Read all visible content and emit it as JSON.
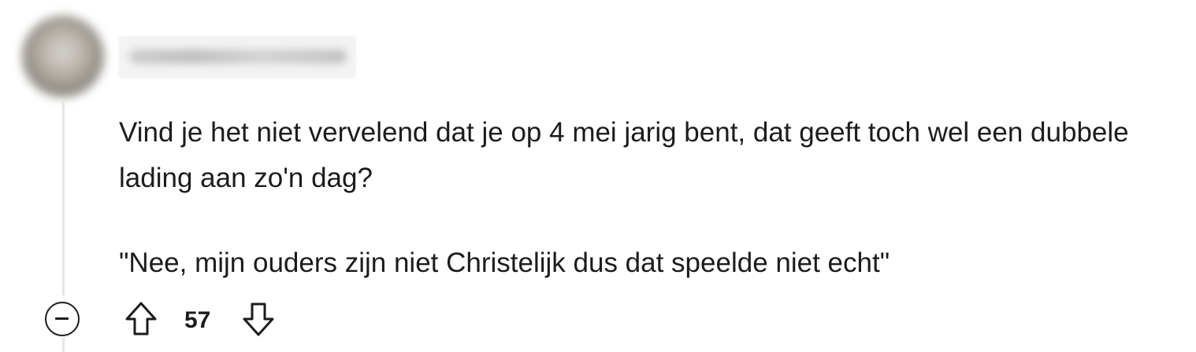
{
  "comment": {
    "username": "username hidden",
    "body_paragraphs": [
      "Vind je het niet vervelend dat je op 4 mei jarig bent, dat geeft toch wel een dubbele lading aan zo'n dag?",
      "\"Nee, mijn ouders zijn niet Christelijk dus dat speelde niet echt\""
    ],
    "actions": {
      "collapse_icon": "minus-circle-icon",
      "upvote_icon": "arrow-up-outline-icon",
      "downvote_icon": "arrow-down-outline-icon",
      "score": "57"
    }
  },
  "colors": {
    "text": "#1c1c1c",
    "thread_line": "#e5e5e5",
    "background": "#ffffff"
  }
}
